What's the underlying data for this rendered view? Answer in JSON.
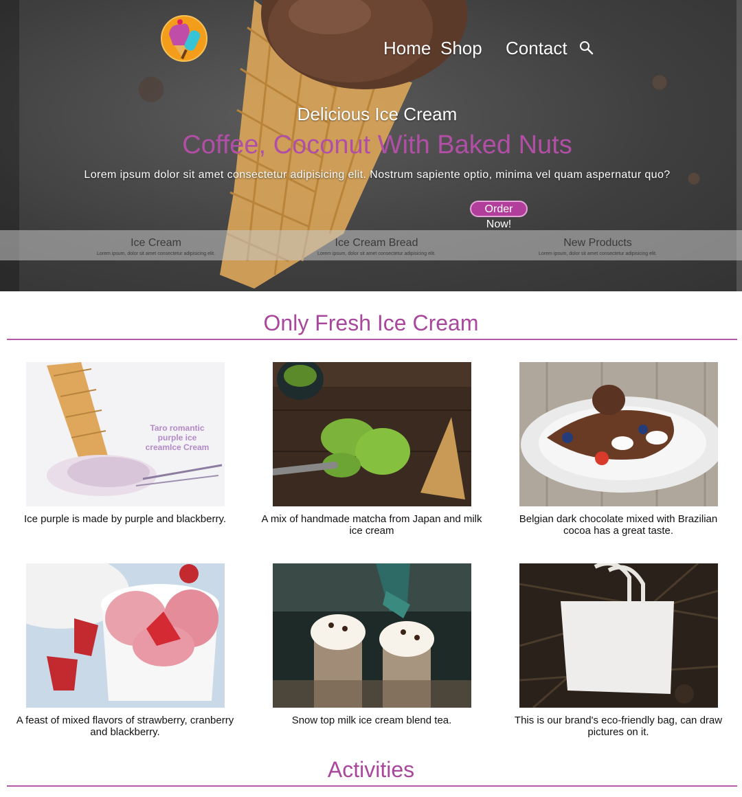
{
  "nav": {
    "items": [
      {
        "label": "Home"
      },
      {
        "label": "Shop"
      },
      {
        "label": "Contact"
      }
    ],
    "search_icon": "search-icon"
  },
  "hero": {
    "subtitle": "Delicious Ice Cream",
    "title": "Coffee, Coconut With Baked Nuts",
    "description": "Lorem ipsum dolor sit amet consectetur adipisicing elit. Nostrum sapiente optio, minima vel quam aspernatur quo?",
    "cta_label": "Order Now!",
    "features": [
      {
        "title": "Ice Cream",
        "desc": "Lorem ipsum, dolor sit amet consectetur adipisicing elit."
      },
      {
        "title": "Ice Cream Bread",
        "desc": "Lorem ipsum, dolor sit amet consectetur adipisicing elit."
      },
      {
        "title": "New Products",
        "desc": "Lorem ipsum, dolor sit amet consectetur adipisicing elit."
      }
    ]
  },
  "fresh": {
    "title": "Only Fresh Ice Cream",
    "products": [
      {
        "caption": "Ice purple is made by purple and blackberry.",
        "image_text": "Taro romantic purple ice creamIce Cream"
      },
      {
        "caption": "A mix of handmade matcha from Japan and milk ice cream"
      },
      {
        "caption": "Belgian dark chocolate mixed with Brazilian cocoa has a great taste."
      },
      {
        "caption": "A feast of mixed flavors of strawberry, cranberry and blackberry."
      },
      {
        "caption": "Snow top milk ice cream blend tea."
      },
      {
        "caption": "This is our brand's eco-friendly bag, can draw pictures on it."
      }
    ]
  },
  "activities": {
    "title": "Activities"
  },
  "colors": {
    "accent": "#a9479d",
    "button": "#b23e9b"
  }
}
